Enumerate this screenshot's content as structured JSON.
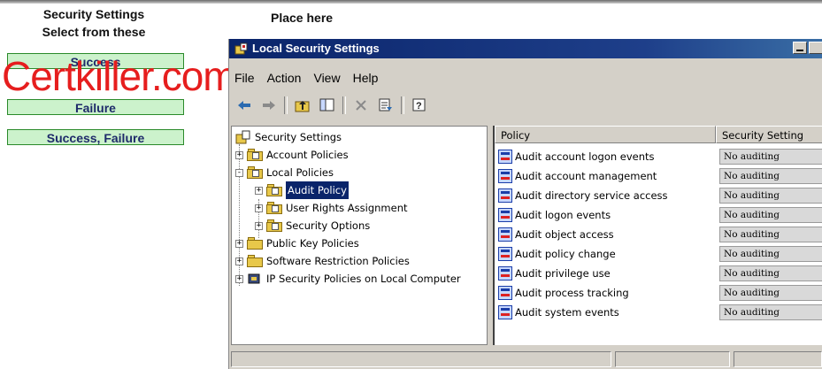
{
  "left_panel": {
    "title_line1": "Security Settings",
    "title_line2": "Select from these",
    "place_here": "Place here",
    "choices": [
      "Success",
      "Failure",
      "Success, Failure"
    ],
    "watermark": "Certkiller.com"
  },
  "window": {
    "title": "Local Security Settings",
    "menu": [
      "File",
      "Action",
      "View",
      "Help"
    ],
    "toolbar_icons": [
      "back-arrow-icon",
      "forward-arrow-icon",
      "up-folder-icon",
      "show-tree-icon",
      "delete-icon",
      "export-list-icon",
      "help-icon"
    ],
    "tree": {
      "root": "Security Settings",
      "items": [
        {
          "label": "Account Policies",
          "expander": "+"
        },
        {
          "label": "Local Policies",
          "expander": "-"
        },
        {
          "label": "Audit Policy",
          "expander": "+",
          "selected": true
        },
        {
          "label": "User Rights Assignment",
          "expander": "+"
        },
        {
          "label": "Security Options",
          "expander": "+"
        },
        {
          "label": "Public Key Policies",
          "expander": "+"
        },
        {
          "label": "Software Restriction Policies",
          "expander": "+"
        },
        {
          "label": "IP Security Policies on Local Computer",
          "expander": "+"
        }
      ]
    },
    "list": {
      "columns": [
        "Policy",
        "Security Setting"
      ],
      "rows": [
        {
          "policy": "Audit account logon events",
          "setting": "No auditing"
        },
        {
          "policy": "Audit account management",
          "setting": "No auditing"
        },
        {
          "policy": "Audit directory service access",
          "setting": "No auditing"
        },
        {
          "policy": "Audit logon events",
          "setting": "No auditing"
        },
        {
          "policy": "Audit object access",
          "setting": "No auditing"
        },
        {
          "policy": "Audit policy change",
          "setting": "No auditing"
        },
        {
          "policy": "Audit privilege use",
          "setting": "No auditing"
        },
        {
          "policy": "Audit process tracking",
          "setting": "No auditing"
        },
        {
          "policy": "Audit system events",
          "setting": "No auditing"
        }
      ]
    }
  },
  "colors": {
    "choice_bg": "#ccf2cc",
    "choice_border": "#2a8a2a",
    "watermark": "#e61e1e",
    "titlebar": "#0a246a",
    "selection": "#0a246a"
  }
}
